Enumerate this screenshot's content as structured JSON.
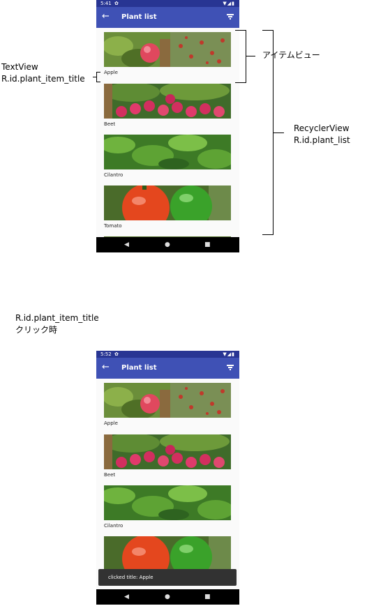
{
  "screen1": {
    "status_time": "5:41",
    "app_title": "Plant list",
    "items": [
      {
        "label": "Apple",
        "img": "apple"
      },
      {
        "label": "Beet",
        "img": "beet"
      },
      {
        "label": "Cilantro",
        "img": "cilantro"
      },
      {
        "label": "Tomato",
        "img": "tomato"
      }
    ]
  },
  "screen2": {
    "status_time": "5:52",
    "app_title": "Plant list",
    "items": [
      {
        "label": "Apple",
        "img": "apple"
      },
      {
        "label": "Beet",
        "img": "beet"
      },
      {
        "label": "Cilantro",
        "img": "cilantro"
      },
      {
        "label": "",
        "img": "tomato"
      }
    ],
    "toast": "clicked title: Apple"
  },
  "annotations": {
    "textview_line1": "TextView",
    "textview_line2": "R.id.plant_item_title",
    "item_view": "アイテムビュー",
    "recycler_line1": "RecyclerView",
    "recycler_line2": "R.id.plant_list",
    "click_line1": "R.id.plant_item_title",
    "click_line2": "クリック時"
  },
  "icons": [
    "back-arrow-icon",
    "filter-icon",
    "gear-icon",
    "wifi-icon",
    "signal-icon",
    "battery-icon",
    "nav-back-icon",
    "nav-home-icon",
    "nav-recents-icon"
  ],
  "colors": {
    "appbar": "#3f51b5",
    "statusbar": "#283593",
    "toast": "#323232",
    "navbar": "#000000"
  }
}
